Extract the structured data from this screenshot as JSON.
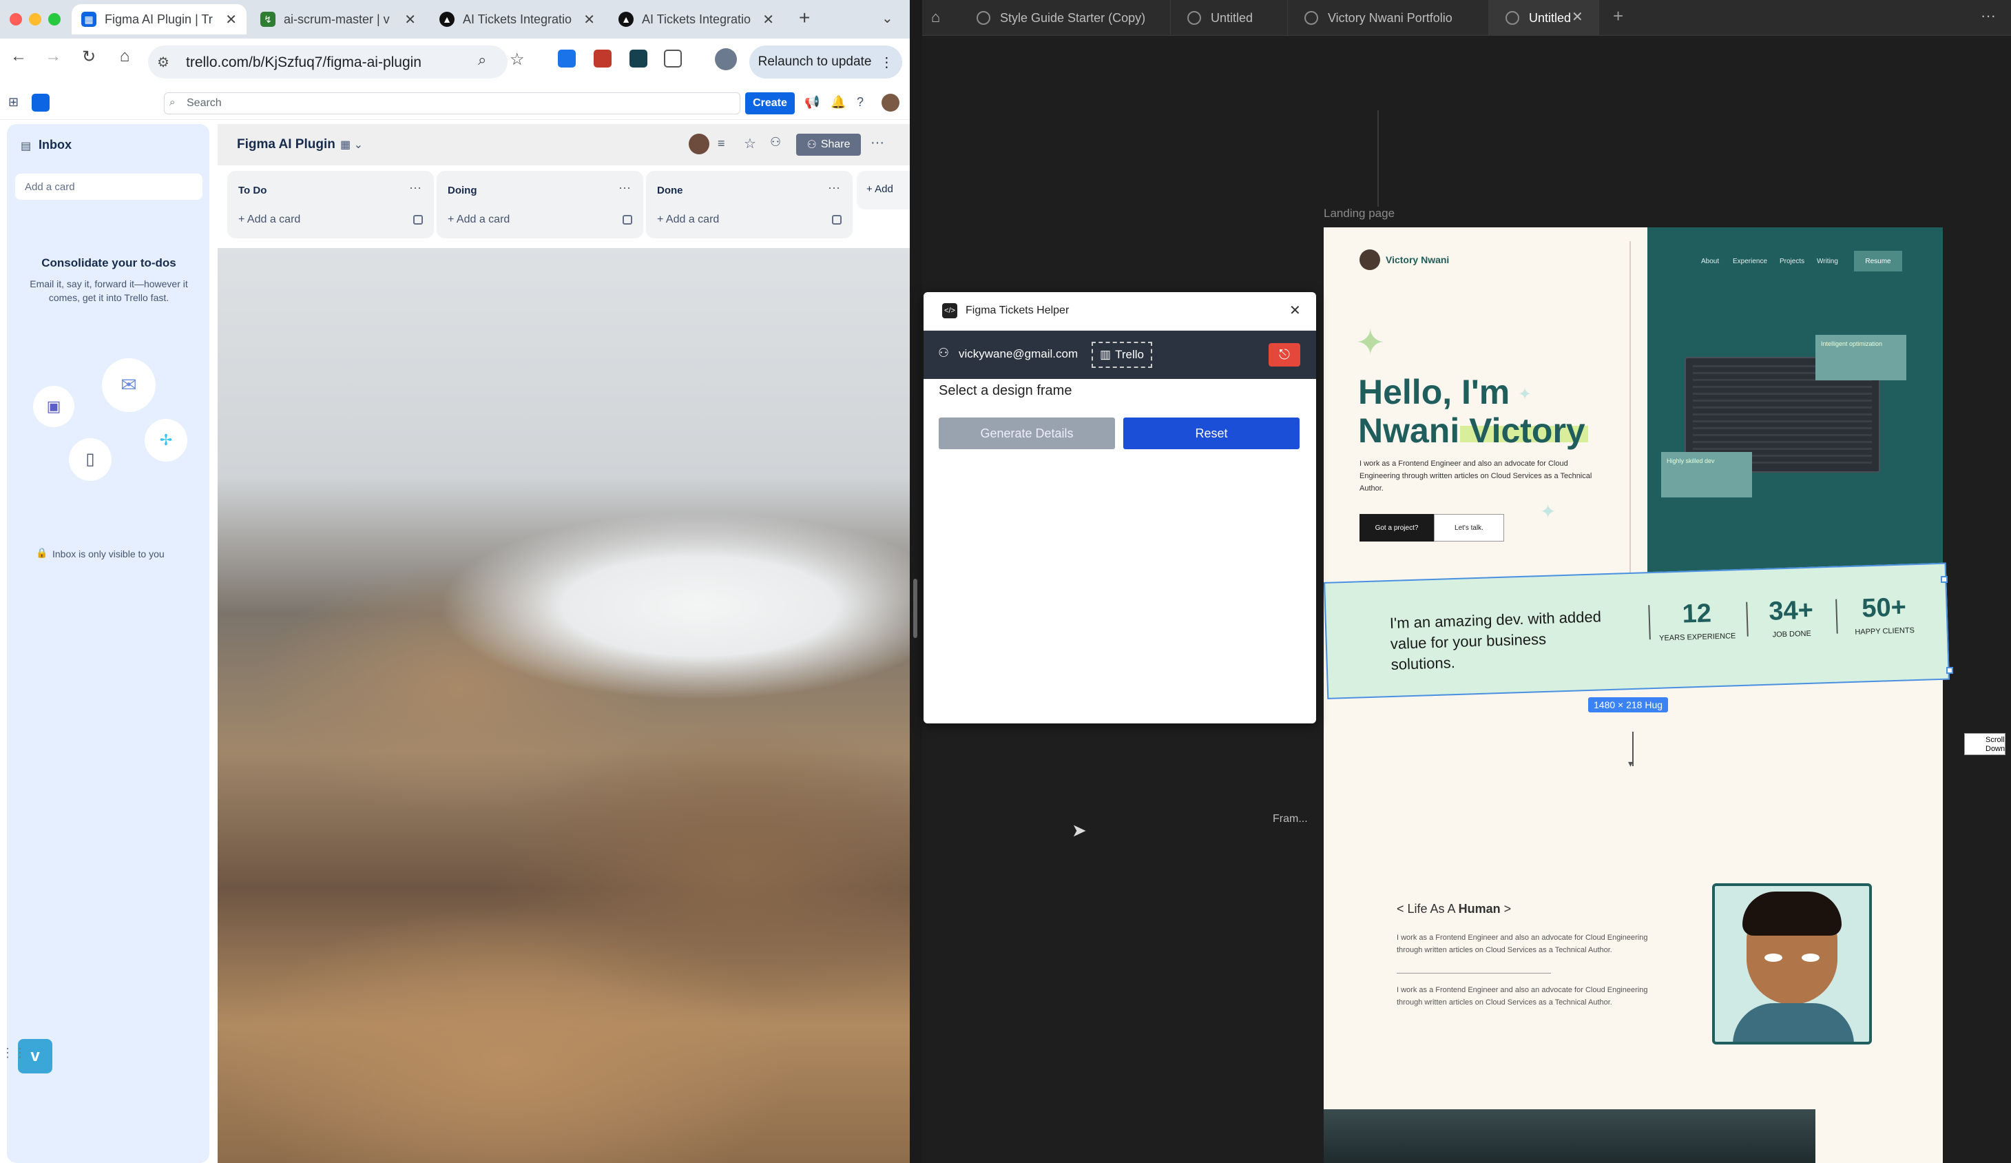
{
  "browser": {
    "tabs": [
      {
        "label": "Figma AI Plugin | Tr"
      },
      {
        "label": "ai-scrum-master | v"
      },
      {
        "label": "AI Tickets Integratio"
      },
      {
        "label": "AI Tickets Integratio"
      }
    ],
    "url": "trello.com/b/KjSzfuq7/figma-ai-plugin",
    "relaunch": "Relaunch to update"
  },
  "trello": {
    "search_placeholder": "Search",
    "create": "Create",
    "inbox": {
      "title": "Inbox",
      "add_card": "Add a card",
      "heading": "Consolidate your to-dos",
      "desc": "Email it, say it, forward it—however it comes, get it into Trello fast.",
      "privacy": "Inbox is only visible to you"
    },
    "board": {
      "name": "Figma AI Plugin",
      "share": "Share",
      "add_list": "+ Add",
      "lists": [
        {
          "title": "To Do",
          "add": "Add a card"
        },
        {
          "title": "Doing",
          "add": "Add a card"
        },
        {
          "title": "Done",
          "add": "Add a card"
        }
      ]
    }
  },
  "figma": {
    "tabs": [
      "Style Guide Starter (Copy)",
      "Untitled",
      "Victory Nwani Portfolio",
      "Untitled"
    ],
    "frame_label": "Landing page",
    "side_label": "Fram...",
    "side_chip": "Scroll Down",
    "size_badge": "1480 × 218 Hug",
    "portfolio": {
      "brand": "Victory Nwani",
      "nav": [
        "About",
        "Experience",
        "Projects",
        "Writing",
        "Resume"
      ],
      "hero_line1": "Hello, I'm",
      "hero_line2": "Nwani Victory",
      "hero_desc": "I work as a Frontend Engineer and also an advocate for Cloud Engineering through written articles on Cloud Services as a Technical Author.",
      "btn_project": "Got a project?",
      "btn_talk": "Let's talk.",
      "card1": "Intelligent optimization",
      "card2": "Highly skilled dev",
      "band_text": "I'm an amazing dev. with added value for your business solutions.",
      "stats": [
        {
          "value": "12",
          "label": "YEARS EXPERIENCE"
        },
        {
          "value": "34+",
          "label": "JOB DONE"
        },
        {
          "value": "50+",
          "label": "HAPPY CLIENTS"
        }
      ],
      "life_pre": "< Life As A ",
      "life_bold": "Human",
      "life_post": " >",
      "life_p1": "I work as a Frontend Engineer and also an advocate for Cloud Engineering through written articles on Cloud Services as a Technical Author.",
      "life_p2": "I work as a Frontend Engineer and also an advocate for Cloud Engineering through written articles on Cloud Services as a Technical Author."
    }
  },
  "plugin": {
    "title": "Figma Tickets Helper",
    "email": "vickywane@gmail.com",
    "service": "Trello",
    "prompt": "Select a design frame",
    "generate": "Generate Details",
    "reset": "Reset"
  },
  "colors": {
    "trello_blue": "#0c66e4",
    "plugin_blue": "#1c4fd8",
    "teal": "#1f5e5c",
    "mint": "#d7f0df"
  }
}
